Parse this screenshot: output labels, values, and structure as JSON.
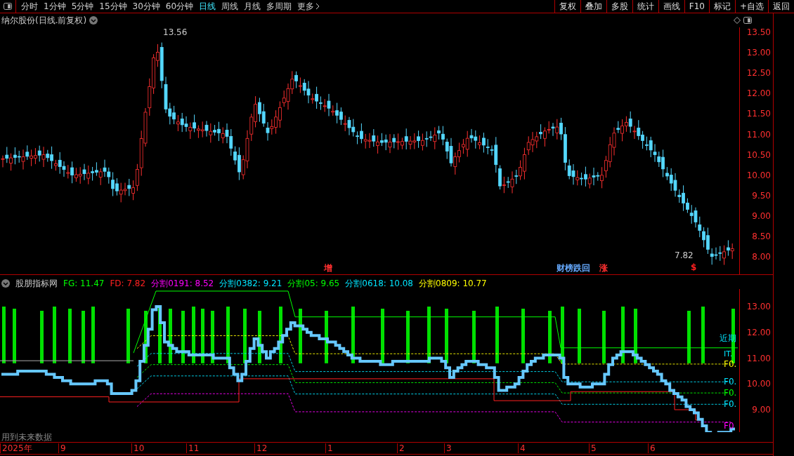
{
  "toolbar": {
    "periods": [
      {
        "label": "分时",
        "selected": false
      },
      {
        "label": "1分钟",
        "selected": false
      },
      {
        "label": "5分钟",
        "selected": false
      },
      {
        "label": "15分钟",
        "selected": false
      },
      {
        "label": "30分钟",
        "selected": false
      },
      {
        "label": "60分钟",
        "selected": false
      },
      {
        "label": "日线",
        "selected": true
      },
      {
        "label": "周线",
        "selected": false
      },
      {
        "label": "月线",
        "selected": false
      },
      {
        "label": "多周期",
        "selected": false
      },
      {
        "label": "更多",
        "selected": false
      }
    ],
    "buttons": [
      "复权",
      "叠加",
      "多股",
      "统计",
      "画线",
      "F10",
      "标记",
      "+自选",
      "返回"
    ]
  },
  "chart": {
    "title": "纳尔股份(日线.前复权)",
    "high_label": "13.56",
    "low_label": "7.82",
    "y_axis": [
      "13.50",
      "13.00",
      "12.50",
      "12.00",
      "11.50",
      "11.00",
      "10.50",
      "10.00",
      "9.50",
      "9.00",
      "8.50",
      "8.00"
    ],
    "markers": [
      {
        "text": "增",
        "color": "#ff3030"
      },
      {
        "text": "财榜跌回",
        "color": "#66aaff"
      },
      {
        "text": "涨",
        "color": "#ff3030"
      },
      {
        "text": "$",
        "color": "#ff2020"
      }
    ]
  },
  "indicator": {
    "name": "股朋指标网",
    "values": [
      {
        "text": "FG: 11.47",
        "color": "#00ff00"
      },
      {
        "text": "FD: 7.82",
        "color": "#ff2020"
      },
      {
        "text": "分割0191: 8.52",
        "color": "#ff00ff"
      },
      {
        "text": "分割0382: 9.21",
        "color": "#00e5ff"
      },
      {
        "text": "分割05: 9.65",
        "color": "#00ff00"
      },
      {
        "text": "分割0618: 10.08",
        "color": "#00e5ff"
      },
      {
        "text": "分割0809: 10.77",
        "color": "#ffff00"
      }
    ],
    "side_notes": [
      "近期",
      "IT."
    ],
    "levels": [
      {
        "text": "F0.",
        "color": "#ffff00"
      },
      {
        "text": "F0.",
        "color": "#00e5ff"
      },
      {
        "text": "F0.",
        "color": "#00ff00"
      },
      {
        "text": "F0.",
        "color": "#00e5ff"
      },
      {
        "text": "F0",
        "color": "#ff00ff"
      }
    ],
    "y_axis": [
      "13.00",
      "12.00",
      "11.00",
      "10.00",
      "9.00"
    ]
  },
  "footer_note": "用到未来数据",
  "time_axis": [
    "2025年",
    "9",
    "10",
    "11",
    "12",
    "1",
    "2",
    "3",
    "4",
    "5",
    "6"
  ]
}
